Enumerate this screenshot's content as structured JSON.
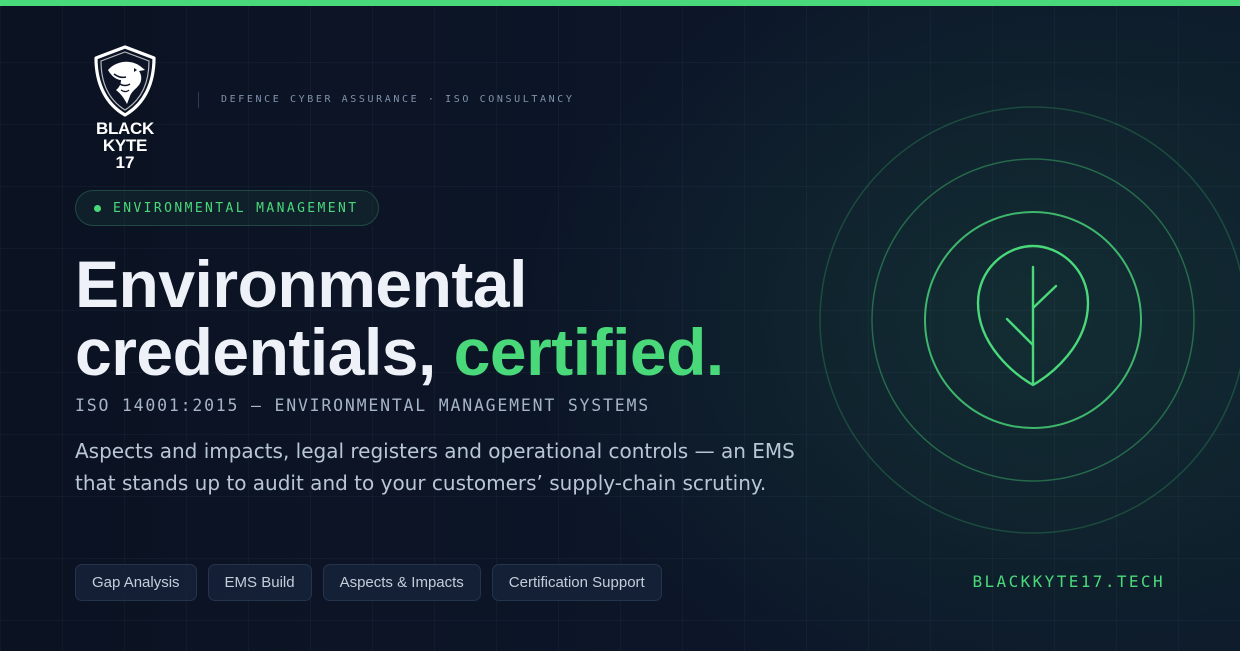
{
  "brand": {
    "name": "BLACK KYTE",
    "number": "17",
    "tagline": "DEFENCE CYBER ASSURANCE · ISO CONSULTANCY",
    "logo_icon": "eagle-shield-icon",
    "accent_color": "#4ad97a"
  },
  "badge": {
    "label": "ENVIRONMENTAL MANAGEMENT"
  },
  "headline": {
    "line1": "Environmental",
    "line2_main": "credentials, ",
    "line2_accent": "certified."
  },
  "standard": "ISO 14001:2015 — ENVIRONMENTAL MANAGEMENT SYSTEMS",
  "description": "Aspects and impacts, legal registers and operational controls — an EMS that stands up to audit and to your customers’ supply-chain scrutiny.",
  "services": [
    "Gap Analysis",
    "EMS Build",
    "Aspects & Impacts",
    "Certification Support"
  ],
  "website": "BLACKKYTE17.TECH",
  "emblem_icon": "leaf-icon"
}
